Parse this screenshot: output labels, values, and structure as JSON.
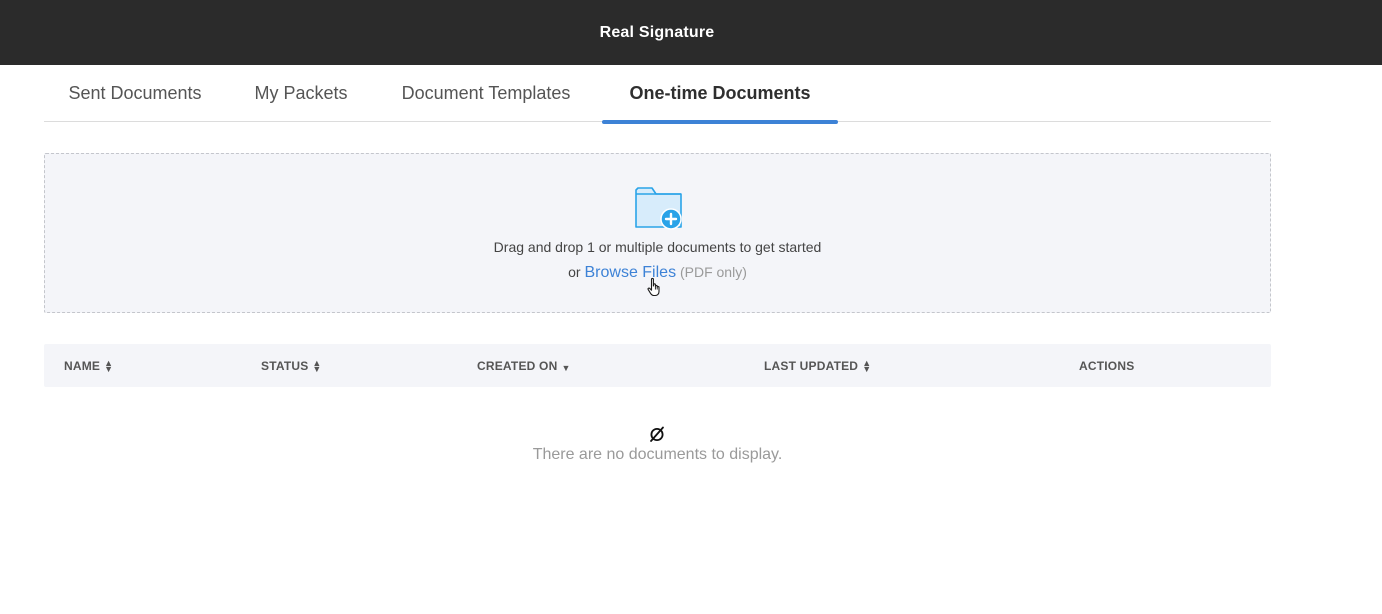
{
  "app": {
    "title": "Real Signature"
  },
  "tabs": [
    {
      "label": "Sent Documents",
      "active": false
    },
    {
      "label": "My Packets",
      "active": false
    },
    {
      "label": "Document Templates",
      "active": false
    },
    {
      "label": "One-time Documents",
      "active": true
    }
  ],
  "dropzone": {
    "icon": "folder-plus-icon",
    "instruction": "Drag and drop 1 or multiple documents to get started",
    "or_text": "or",
    "browse_label": "Browse Files",
    "hint": "(PDF only)"
  },
  "table": {
    "columns": [
      {
        "label": "NAME",
        "sort": "both"
      },
      {
        "label": "STATUS",
        "sort": "both"
      },
      {
        "label": "CREATED ON",
        "sort": "desc"
      },
      {
        "label": "LAST UPDATED",
        "sort": "both"
      },
      {
        "label": "ACTIONS",
        "sort": "none"
      }
    ],
    "empty_icon": "empty-set-icon",
    "empty_message": "There are no documents to display."
  },
  "colors": {
    "topbar": "#2b2b2b",
    "accent": "#3d82d6",
    "panel": "#f4f5f9",
    "icon_fill": "#b9dcf7",
    "icon_badge": "#2aa3e8"
  }
}
